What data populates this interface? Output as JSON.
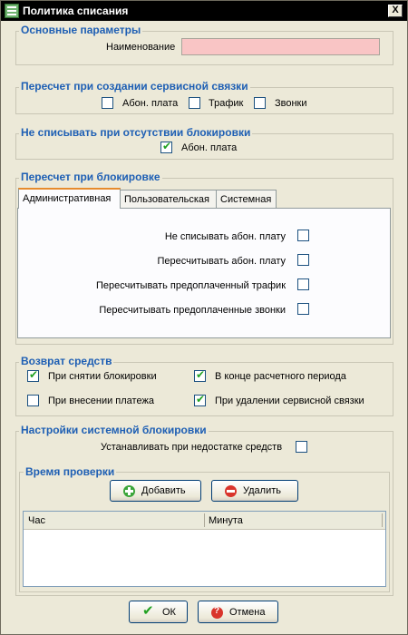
{
  "window": {
    "title": "Политика списания",
    "close_label": "X"
  },
  "main_params": {
    "legend": "Основные параметры",
    "name_label": "Наименование",
    "name_value": ""
  },
  "recalc_on_create": {
    "legend": "Пересчет при создании сервисной связки",
    "items": [
      {
        "label": "Абон. плата",
        "checked": false
      },
      {
        "label": "Трафик",
        "checked": false
      },
      {
        "label": "Звонки",
        "checked": false
      }
    ]
  },
  "no_charge_unblocked": {
    "legend": "Не списывать при отсутствии блокировки",
    "items": [
      {
        "label": "Абон. плата",
        "checked": true
      }
    ]
  },
  "recalc_on_block": {
    "legend": "Пересчет при блокировке",
    "tabs": [
      {
        "label": "Административная",
        "active": true
      },
      {
        "label": "Пользовательская",
        "active": false
      },
      {
        "label": "Системная",
        "active": false
      }
    ],
    "options": [
      {
        "label": "Не списывать абон. плату",
        "checked": false
      },
      {
        "label": "Пересчитывать абон. плату",
        "checked": false
      },
      {
        "label": "Пересчитывать предоплаченный трафик",
        "checked": false
      },
      {
        "label": "Пересчитывать предоплаченные звонки",
        "checked": false
      }
    ]
  },
  "refund": {
    "legend": "Возврат средств",
    "items": [
      {
        "label": "При снятии блокировки",
        "checked": true
      },
      {
        "label": "В конце расчетного периода",
        "checked": true
      },
      {
        "label": "При внесении платежа",
        "checked": false
      },
      {
        "label": "При удалении сервисной связки",
        "checked": true
      }
    ]
  },
  "system_block": {
    "legend": "Настройки системной блокировки",
    "install_label": "Устанавливать при недостатке средств",
    "install_checked": false,
    "check_time": {
      "legend": "Время проверки",
      "add_label": "Добавить",
      "delete_label": "Удалить",
      "columns": [
        "Час",
        "Минута"
      ],
      "rows": []
    }
  },
  "footer": {
    "ok_label": "ОК",
    "cancel_label": "Отмена"
  },
  "colors": {
    "legend": "#1e5fb4",
    "check": "#21a121",
    "name_field": "#f9c5c5",
    "add_icon": "#3aa53a",
    "delete_icon": "#d9342b"
  },
  "icons": {
    "app": "window-app-icon",
    "add": "plus-circle-icon",
    "delete": "minus-circle-icon",
    "ok": "checkmark-icon",
    "cancel": "cancel-circle-icon"
  }
}
